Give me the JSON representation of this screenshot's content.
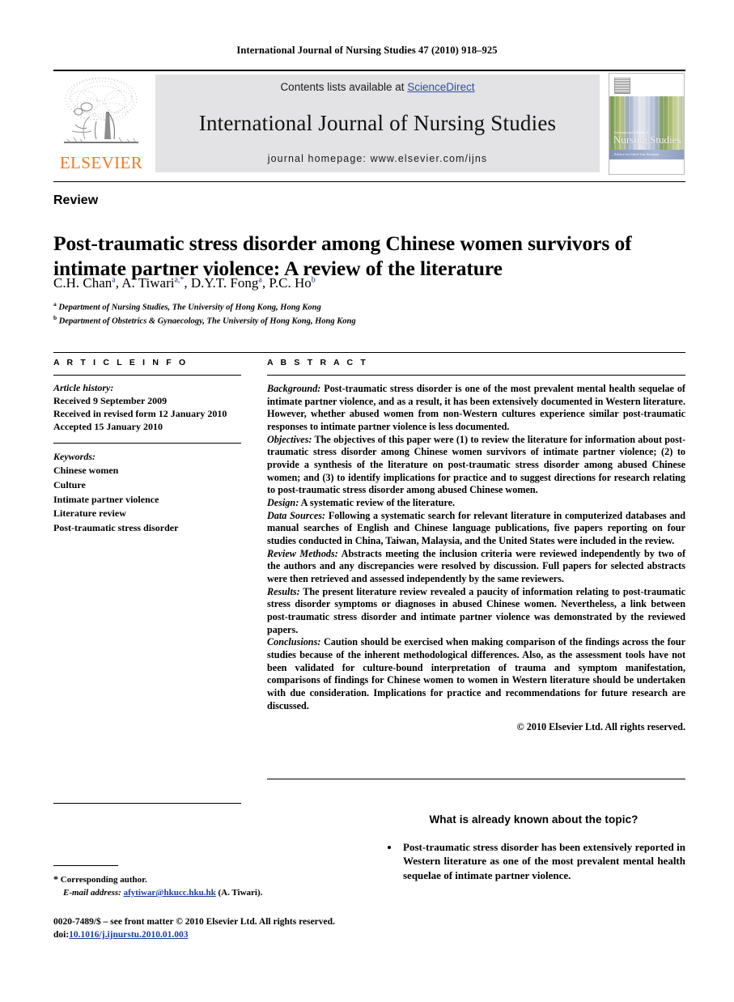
{
  "running_head": "International Journal of Nursing Studies 47 (2010) 918–925",
  "masthead": {
    "publisher_name": "ELSEVIER",
    "contents_prefix": "Contents lists available at ",
    "sciencedirect": "ScienceDirect",
    "journal_title": "International Journal of Nursing Studies",
    "homepage": "journal homepage: www.elsevier.com/ijns",
    "cover": {
      "title": "Nursing Studies",
      "kicker": "International Journal of",
      "footer_line": "Editor-in-Chief  Ian Norman"
    }
  },
  "article": {
    "type": "Review",
    "title": "Post-traumatic stress disorder among Chinese women survivors of intimate partner violence: A review of the literature",
    "authors_html": "C.H. Chan a, A. Tiwari a,*, D.Y.T. Fong a, P.C. Ho b",
    "affiliation_a": "Department of Nursing Studies, The University of Hong Kong, Hong Kong",
    "affiliation_b": "Department of Obstetrics & Gynaecology, The University of Hong Kong, Hong Kong"
  },
  "info": {
    "heading": "A R T I C L E   I N F O",
    "history_label": "Article history:",
    "history": [
      "Received 9 September 2009",
      "Received in revised form 12 January 2010",
      "Accepted 15 January 2010"
    ],
    "keywords_label": "Keywords:",
    "keywords": [
      "Chinese women",
      "Culture",
      "Intimate partner violence",
      "Literature review",
      "Post-traumatic stress disorder"
    ]
  },
  "abstract": {
    "heading": "A B S T R A C T",
    "sections": [
      {
        "label": "Background:",
        "text": " Post-traumatic stress disorder is one of the most prevalent mental health sequelae of intimate partner violence, and as a result, it has been extensively documented in Western literature. However, whether abused women from non-Western cultures experience similar post-traumatic responses to intimate partner violence is less documented."
      },
      {
        "label": "Objectives:",
        "text": " The objectives of this paper were (1) to review the literature for information about post-traumatic stress disorder among Chinese women survivors of intimate partner violence; (2) to provide a synthesis of the literature on post-traumatic stress disorder among abused Chinese women; and (3) to identify implications for practice and to suggest directions for research relating to post-traumatic stress disorder among abused Chinese women."
      },
      {
        "label": "Design:",
        "text": " A systematic review of the literature."
      },
      {
        "label": "Data Sources:",
        "text": " Following a systematic search for relevant literature in computerized databases and manual searches of English and Chinese language publications, five papers reporting on four studies conducted in China, Taiwan, Malaysia, and the United States were included in the review."
      },
      {
        "label": "Review Methods:",
        "text": " Abstracts meeting the inclusion criteria were reviewed independently by two of the authors and any discrepancies were resolved by discussion. Full papers for selected abstracts were then retrieved and assessed independently by the same reviewers."
      },
      {
        "label": "Results:",
        "text": " The present literature review revealed a paucity of information relating to post-traumatic stress disorder symptoms or diagnoses in abused Chinese women. Nevertheless, a link between post-traumatic stress disorder and intimate partner violence was demonstrated by the reviewed papers."
      },
      {
        "label": "Conclusions:",
        "text": " Caution should be exercised when making comparison of the findings across the four studies because of the inherent methodological differences. Also, as the assessment tools have not been validated for culture-bound interpretation of trauma and symptom manifestation, comparisons of findings for Chinese women to women in Western literature should be undertaken with due consideration. Implications for practice and recommendations for future research are discussed."
      }
    ],
    "copyright": "© 2010 Elsevier Ltd. All rights reserved."
  },
  "known_box": {
    "title": "What is already known about the topic?",
    "items": [
      "Post-traumatic stress disorder has been extensively reported in Western literature as one of the most prevalent mental health sequelae of intimate partner violence."
    ]
  },
  "footnotes": {
    "corresponding_marker": "*",
    "corresponding_text": "Corresponding author.",
    "email_label": "E-mail address:",
    "email": "afytiwar@hkucc.hku.hk",
    "email_suffix": " (A. Tiwari).",
    "front_matter": "0020-7489/$ – see front matter © 2010 Elsevier Ltd. All rights reserved.",
    "doi_label": "doi:",
    "doi": "10.1016/j.ijnurstu.2010.01.003"
  }
}
